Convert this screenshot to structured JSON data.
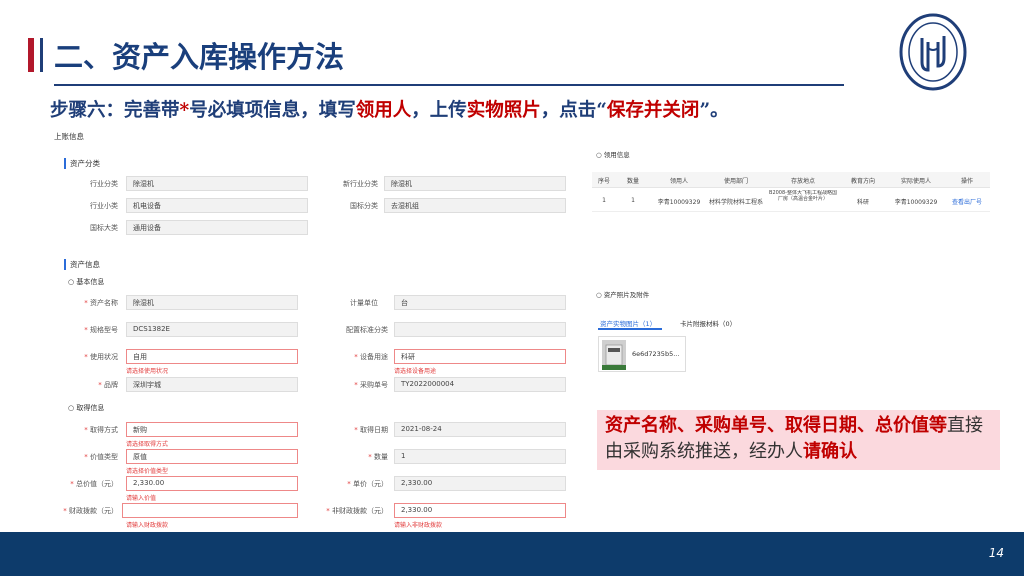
{
  "slide": {
    "title": "二、资产入库操作方法",
    "instruction": {
      "p1": "步骤六：完善带",
      "star": "*",
      "p2": "号必填项信息，填写",
      "r1": "领用人",
      "p3": "，上传",
      "r2": "实物照片",
      "p4": "，点击“",
      "r3": "保存并关闭",
      "p5": "”。"
    },
    "callout": {
      "bold_red": "资产名称、采购单号、取得日期、总价值等",
      "normal": "直接由采购系统推送，经办人",
      "bold_red2": "请确认"
    },
    "page_number": "14"
  },
  "form": {
    "header": "上账信息",
    "category_section": "资产分类",
    "industry_category_label": "行业分类",
    "industry_category_value": "除湿机",
    "new_industry_label": "新行业分类",
    "new_industry_value": "除湿机",
    "industry_class_label": "行业小类",
    "industry_class_value": "机电设备",
    "national_class_label": "国标分类",
    "national_class_value": "去湿机组",
    "national_major_label": "国标大类",
    "national_major_value": "通用设备",
    "asset_info_section": "资产信息",
    "basic_info": "基本信息",
    "asset_name_label": "资产名称",
    "asset_name_value": "除湿机",
    "unit_label": "计量单位",
    "unit_value": "台",
    "spec_label": "规格型号",
    "spec_value": "DCS1382E",
    "config_label": "配置标准分类",
    "usage_label": "使用状况",
    "usage_value": "自用",
    "usage_err": "请选择使用状况",
    "purpose_label": "设备用途",
    "purpose_value": "科研",
    "purpose_err": "请选择设备用途",
    "brand_label": "品牌",
    "brand_value": "深圳宇城",
    "purchase_no_label": "采购单号",
    "purchase_no_value": "TY2022000004",
    "acquire_info": "取得信息",
    "acquire_method_label": "取得方式",
    "acquire_method_value": "新购",
    "acquire_method_err": "请选择取得方式",
    "acquire_date_label": "取得日期",
    "acquire_date_value": "2021-08-24",
    "value_type_label": "价值类型",
    "value_type_value": "原值",
    "value_type_err": "请选择价值类型",
    "quantity_label": "数量",
    "quantity_value": "1",
    "total_label": "总价值（元）",
    "total_value": "2,330.00",
    "total_err": "请输入价值",
    "unit_price_label": "单价（元）",
    "unit_price_value": "2,330.00",
    "fiscal_label": "财政拨款（元）",
    "fiscal_err": "请输入财政拨款",
    "nonfiscal_label": "非财政拨款（元）",
    "nonfiscal_value": "2,330.00",
    "nonfiscal_err": "请输入非财政拨款"
  },
  "receipt": {
    "header": "领用信息",
    "columns": [
      "序号",
      "数量",
      "领用人",
      "使用部门",
      "存放地点",
      "教育方向",
      "实际使用人",
      "操作"
    ],
    "row": [
      "1",
      "1",
      "李青10009329",
      "材料学院材料工程系",
      "B2008-整体大飞机工程战略国厂房（高温合金叶片）",
      "科研",
      "李青10009329",
      "查看出厂号"
    ]
  },
  "attachments": {
    "header": "资产照片及附件",
    "tab1": "资产实物图片（1）",
    "tab2": "卡片附报材料（0）",
    "file_name": "6e6d7235b5..."
  }
}
